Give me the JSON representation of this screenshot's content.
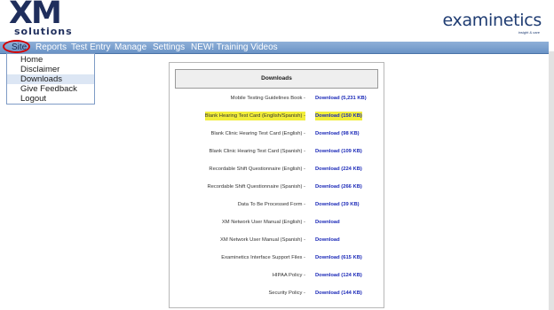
{
  "logo": {
    "main": "XM",
    "sub": "solutions"
  },
  "brand": {
    "name": "examinetics",
    "tagline": "insight & care"
  },
  "menu": {
    "items": [
      {
        "label": "Site"
      },
      {
        "label": "Reports"
      },
      {
        "label": "Test Entry"
      },
      {
        "label": "Manage"
      },
      {
        "label": "Settings"
      },
      {
        "label": "NEW! Training Videos"
      }
    ]
  },
  "site_menu": {
    "items": [
      {
        "label": "Home"
      },
      {
        "label": "Disclaimer"
      },
      {
        "label": "Downloads",
        "active": true
      },
      {
        "label": "Give Feedback"
      },
      {
        "label": "Logout"
      }
    ]
  },
  "downloads": {
    "title": "Downloads",
    "rows": [
      {
        "name": "Mobile Testing Guidelines Book -",
        "link": "Download (5,231 KB)"
      },
      {
        "name": "Blank Hearing Test Card (English/Spanish) -",
        "link": "Download (150 KB)",
        "highlighted": true
      },
      {
        "name": "Blank Clinic Hearing Test Card (English) -",
        "link": "Download (98 KB)"
      },
      {
        "name": "Blank Clinic Hearing Test Card (Spanish) -",
        "link": "Download (109 KB)"
      },
      {
        "name": "Recordable Shift Questionnaire (English) -",
        "link": "Download (224 KB)"
      },
      {
        "name": "Recordable Shift Questionnaire (Spanish) -",
        "link": "Download (266 KB)"
      },
      {
        "name": "Data To Be Processed Form -",
        "link": "Download (39 KB)"
      },
      {
        "name": "XM Network User Manual (English) -",
        "link": "Download"
      },
      {
        "name": "XM Network User Manual (Spanish) -",
        "link": "Download"
      },
      {
        "name": "Examinetics Interface Support Files -",
        "link": "Download (615 KB)"
      },
      {
        "name": "HIPAA Policy -",
        "link": "Download (124 KB)"
      },
      {
        "name": "Security Policy -",
        "link": "Download (144 KB)"
      }
    ]
  },
  "colors": {
    "menubar": "#7aa0d0",
    "link": "#1c2ab8",
    "highlight": "#f2ee3a",
    "annotation_ring": "#d40000"
  }
}
